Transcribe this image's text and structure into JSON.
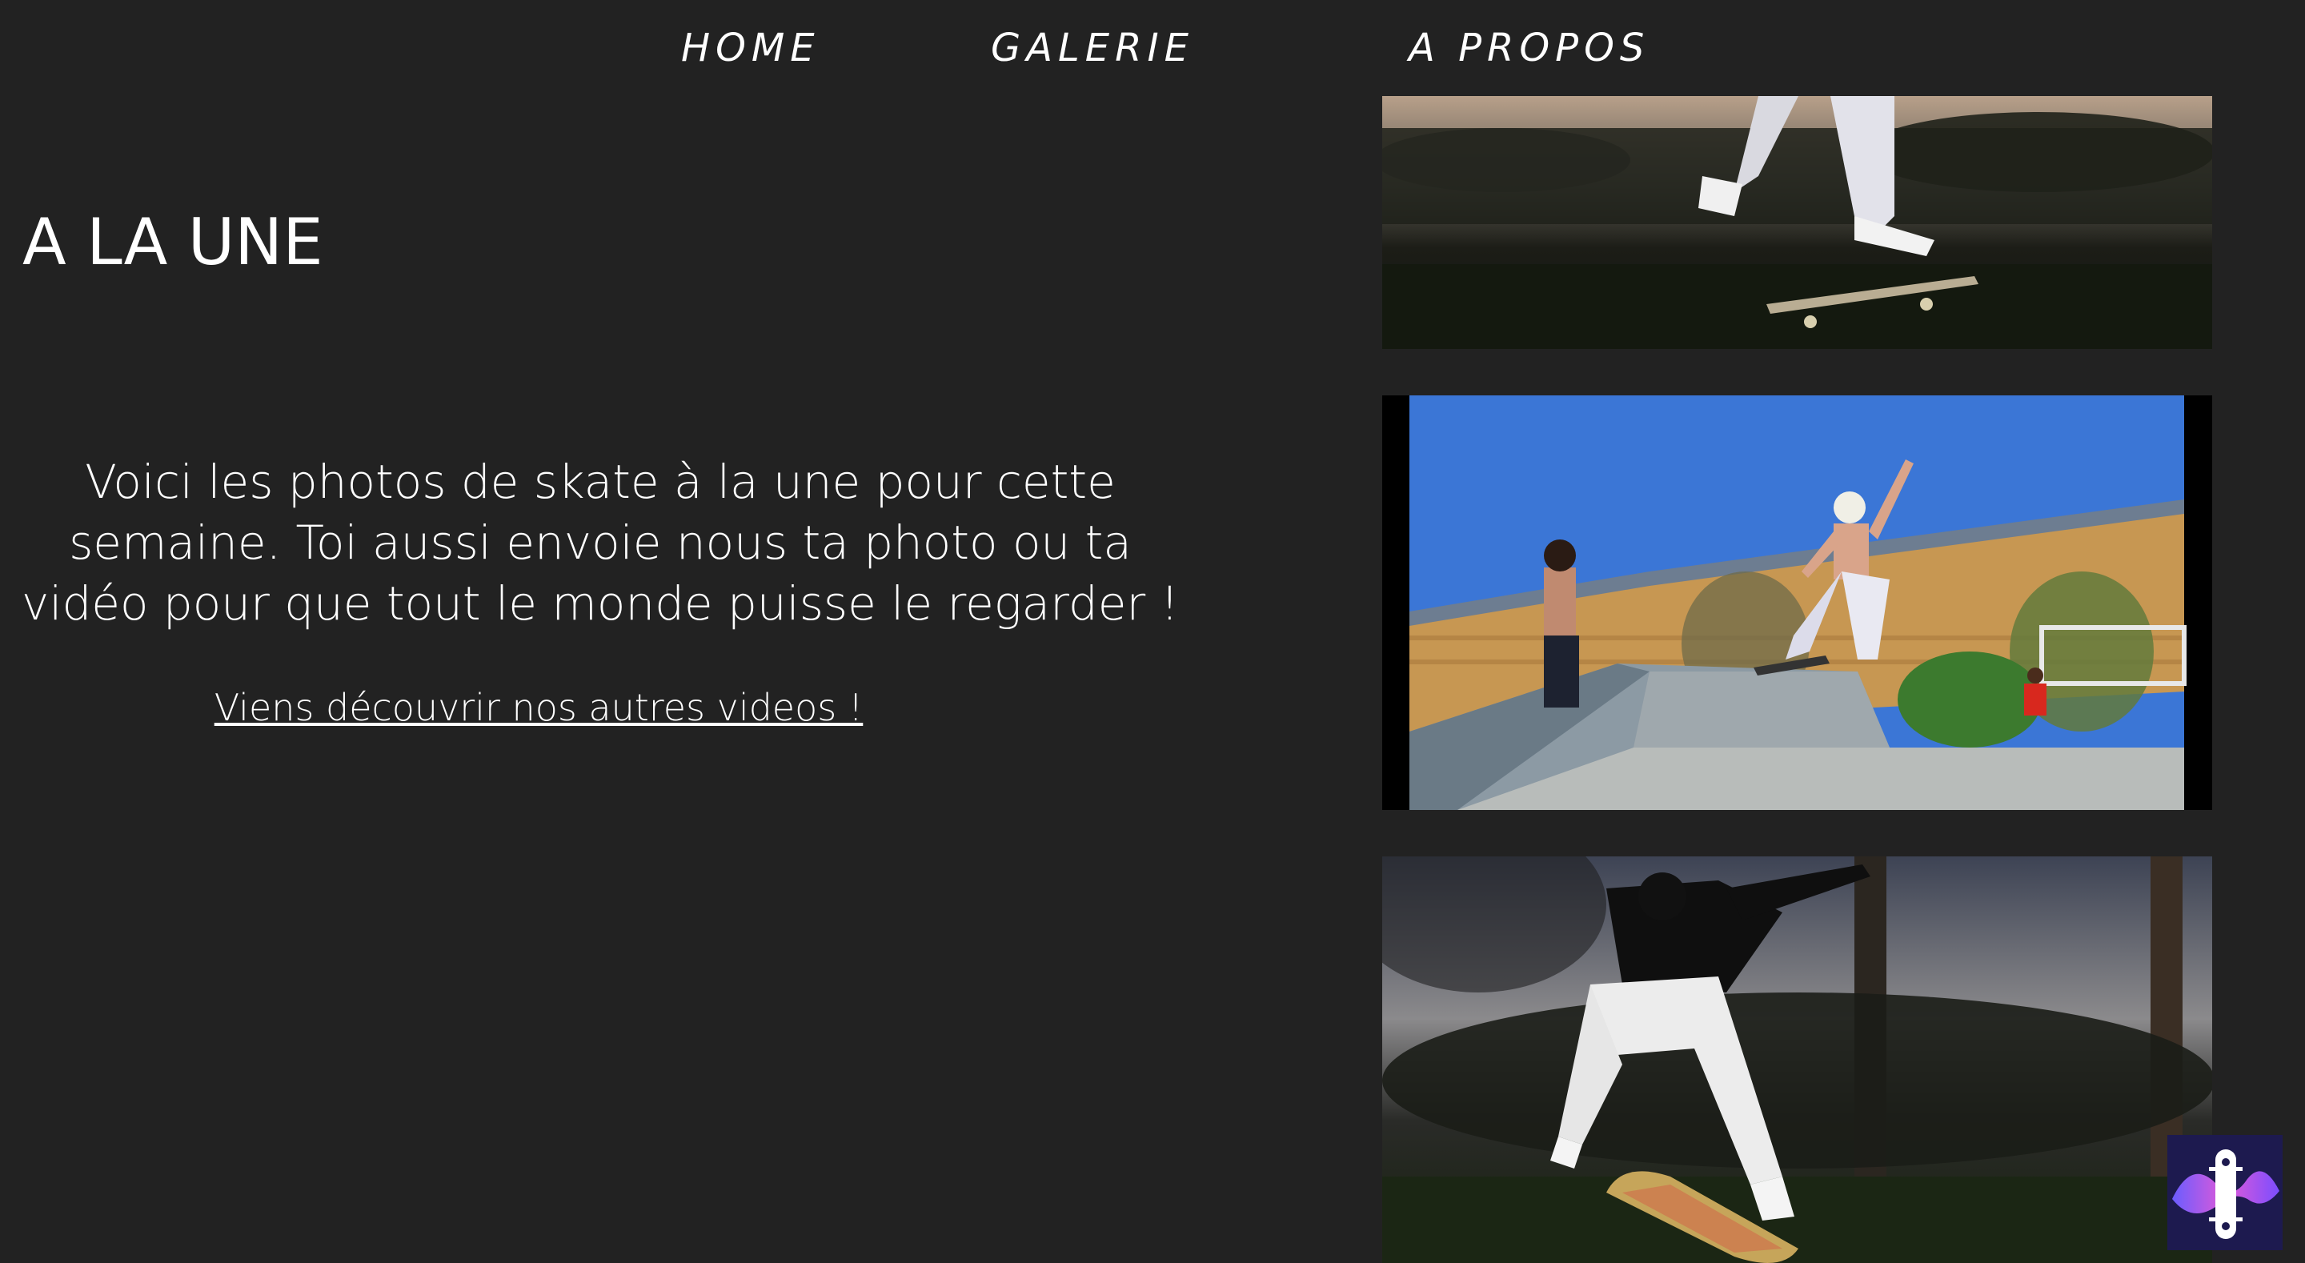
{
  "nav": {
    "items": [
      {
        "label": "HOME"
      },
      {
        "label": "GALERIE"
      },
      {
        "label": "A PROPOS"
      }
    ]
  },
  "main": {
    "headline": "A LA UNE",
    "intro": "Voici les photos de skate à la une pour cette semaine. Toi aussi envoie nous ta photo ou ta vidéo pour que tout le monde puisse le regarder !",
    "more_link": "Viens découvrir nos autres videos !"
  },
  "photos": [
    {
      "subject": "skater-jump-dusk"
    },
    {
      "subject": "skater-ollie-skatepark-blue-sky"
    },
    {
      "subject": "skater-kickflip-dusk"
    }
  ],
  "colors": {
    "background": "#222222",
    "text": "#ffffff",
    "badge_bg": "#1d1a4f"
  },
  "app_badge": {
    "icon": "skateboard-wave-icon"
  }
}
